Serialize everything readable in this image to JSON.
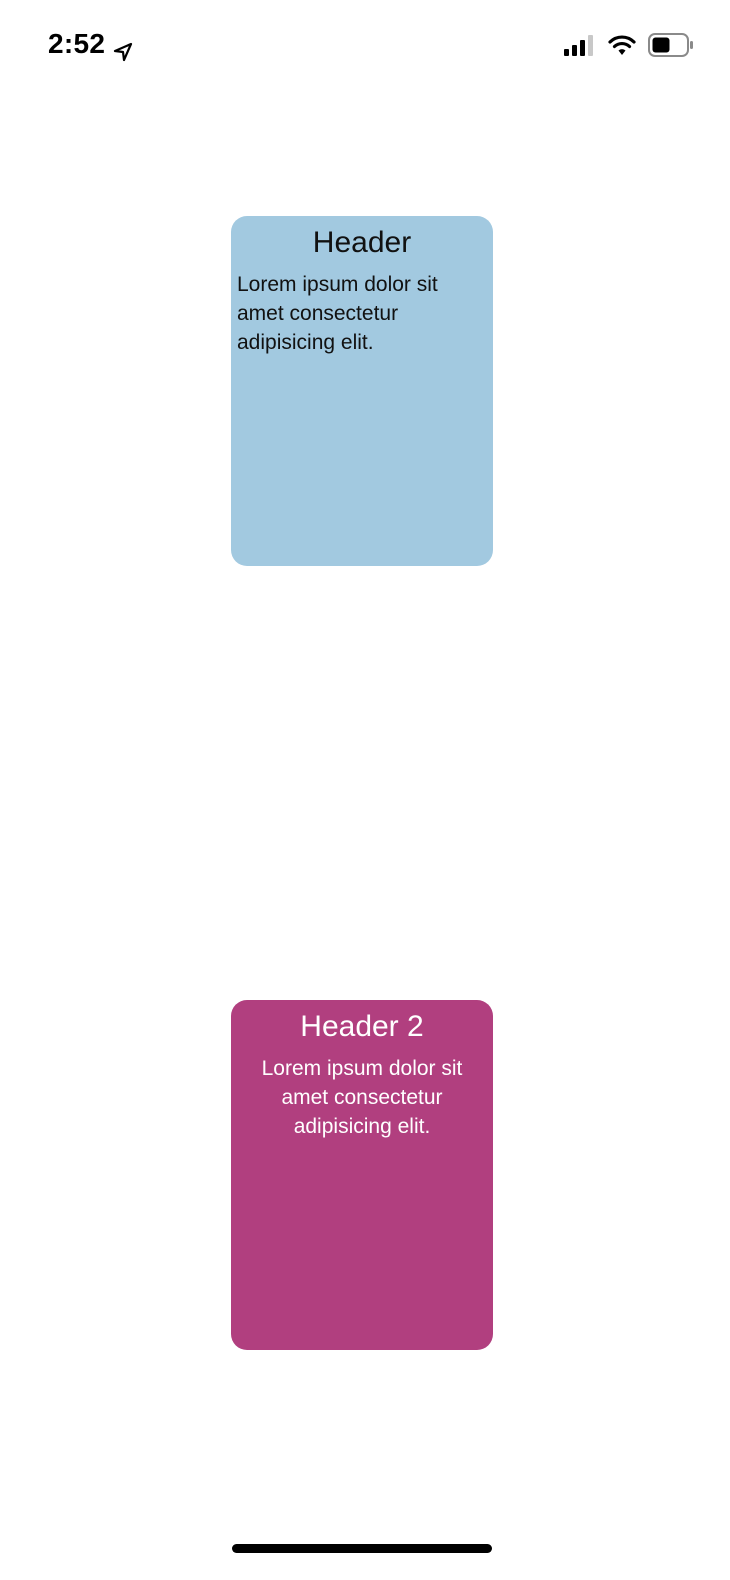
{
  "status_bar": {
    "time": "2:52",
    "icons": [
      "location-arrow-icon",
      "cellular-signal-icon",
      "wifi-icon",
      "battery-icon"
    ]
  },
  "cards": [
    {
      "header": "Header",
      "body": "Lorem ipsum dolor sit amet consectetur adipisicing elit.",
      "background": "#a2c9e0",
      "text_color": "#111111",
      "text_align": "left"
    },
    {
      "header": "Header 2",
      "body": "Lorem ipsum dolor sit amet consectetur adipisicing elit.",
      "background": "#b13f7f",
      "text_color": "#ffffff",
      "text_align": "center"
    }
  ]
}
